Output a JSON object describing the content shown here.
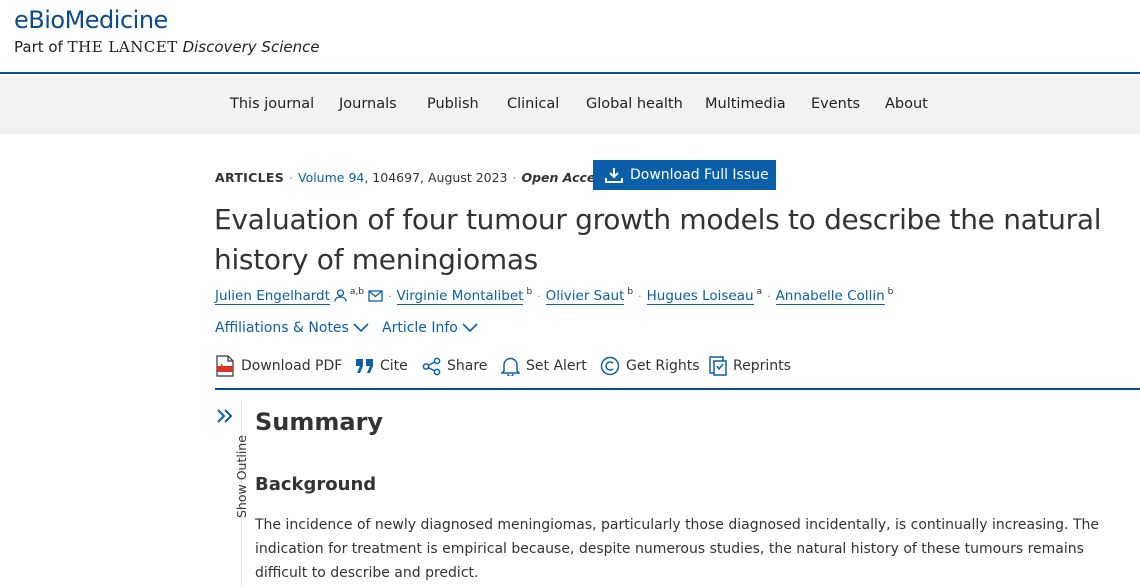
{
  "header": {
    "brand": "eBioMedicine",
    "sub_prefix": "Part of",
    "sub_lancet": "THE LANCET",
    "sub_discovery": "Discovery Science"
  },
  "nav": [
    "This journal",
    "Journals",
    "Publish",
    "Clinical",
    "Global health",
    "Multimedia",
    "Events",
    "About"
  ],
  "meta": {
    "section": "ARTICLES",
    "volume": "Volume 94",
    "details": ", 104697, August 2023",
    "open_access": "Open Access",
    "download_issue": "Download Full Issue"
  },
  "title": "Evaluation of four tumour growth models to describe the natural history of meningiomas",
  "authors": [
    {
      "name": "Julien Engelhardt",
      "sup": "a,b"
    },
    {
      "name": "Virginie Montalibet",
      "sup": "b"
    },
    {
      "name": "Olivier Saut",
      "sup": "b"
    },
    {
      "name": "Hugues Loiseau",
      "sup": "a"
    },
    {
      "name": "Annabelle Collin",
      "sup": "b"
    }
  ],
  "toggles": {
    "affiliations": "Affiliations & Notes",
    "article_info": "Article Info"
  },
  "toolbar": {
    "pdf": "Download PDF",
    "cite": "Cite",
    "share": "Share",
    "alert": "Set Alert",
    "rights": "Get Rights",
    "reprints": "Reprints"
  },
  "outline": {
    "label": "Show Outline"
  },
  "content": {
    "summary": "Summary",
    "background_heading": "Background",
    "background_text": "The incidence of newly diagnosed meningiomas, particularly those diagnosed incidentally, is continually increasing. The indication for treatment is empirical because, despite numerous studies, the natural history of these tumours remains difficult to describe and predict."
  },
  "colors": {
    "accent": "#0a5fa8",
    "rule": "#0a4c8a",
    "nav_bg": "#f2f2f2"
  }
}
